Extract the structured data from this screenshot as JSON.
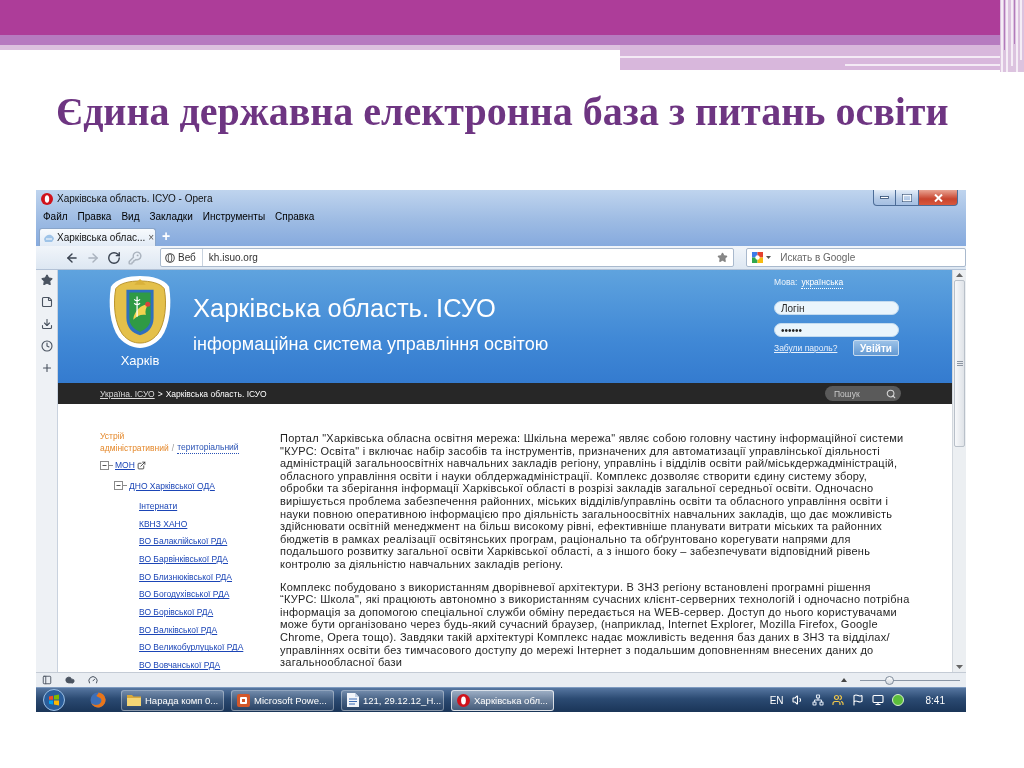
{
  "slide": {
    "title": "Єдина державна електронна база з питань освіти"
  },
  "window": {
    "title": "Харківська область. ІСУО - Opera",
    "menu": [
      "Файл",
      "Правка",
      "Вид",
      "Закладки",
      "Инструменты",
      "Справка"
    ],
    "tabs": [
      {
        "label": "Харківська облас...",
        "close": "×",
        "selected": true
      }
    ],
    "new_tab": "+",
    "nav": [
      {
        "kind": "back",
        "disabled": false
      },
      {
        "kind": "forward",
        "disabled": true
      },
      {
        "kind": "reload",
        "disabled": false
      },
      {
        "kind": "key",
        "disabled": true
      }
    ],
    "address": {
      "badge": "Веб",
      "url": "kh.isuo.org"
    },
    "search": {
      "placeholder": "Искать в Google"
    }
  },
  "page": {
    "banner": {
      "city": "Харків",
      "title": "Харківська область. ІСУО",
      "subtitle": "інформаційна система управління освітою",
      "language_label": "Мова:",
      "language": "українська",
      "login": {
        "placeholder": "Логін"
      },
      "password": {
        "value": "••••••"
      },
      "forgot_link": "Забули пароль?",
      "submit": "Увійти"
    },
    "breadcrumb": {
      "items": [
        {
          "label": "Україна. ІСУО",
          "kind": "link"
        },
        {
          "label": "Харківська область. ІСУО",
          "kind": "current"
        }
      ],
      "separator": ">"
    },
    "site_search": {
      "placeholder": "Пошук"
    },
    "structure": {
      "label": "Устрій",
      "separator": "/",
      "modes": [
        {
          "label": "адміністративний",
          "selected": true
        },
        {
          "label": "територіальний",
          "selected": false
        }
      ]
    },
    "tree": [
      {
        "label": "МОН",
        "expanded": true,
        "external": true,
        "children": [
          {
            "label": "ДНО Харківської ОДА",
            "expanded": true,
            "external": false,
            "children": [
              {
                "label": "Інтернати"
              },
              {
                "label": "КВНЗ ХАНО"
              },
              {
                "label": "ВО Балаклійської РДА"
              },
              {
                "label": "ВО Барвінківської РДА"
              },
              {
                "label": "ВО Близнюківської РДА"
              },
              {
                "label": "ВО Богодухівської РДА"
              },
              {
                "label": "ВО Борівської РДА"
              },
              {
                "label": "ВО Валківської РДА"
              },
              {
                "label": "ВО Великобурлуцької РДА"
              },
              {
                "label": "ВО Вовчанської РДА"
              }
            ]
          }
        ]
      }
    ],
    "paragraphs": [
      "Портал \"Харківська обласна освітня мережа: Шкільна мережа\" являє собою головну частину інформаційної системи \"КУРС: Освіта\" і включає набір засобів та інструментів, призначених для автоматизації управлінської діяльності адміністрацій загальноосвітніх навчальних закладів регіону, управлінь і відділів освіти рай/міськдержадміністрацій, обласного управління освіти і науки облдержадміністрації. Комплекс дозволяє створити єдину систему збору, обробки та зберігання інформації Харківської області в розрізі закладів загальної середньої освіти. Одночасно вирішується проблема забезпечення районних, міських відділів/управлінь освіти та обласного управління освіти і науки повною оперативною інформацією про діяльність загальноосвітніх навчальних закладів, що дає можливість здійснювати освітній менеджмент на більш високому рівні, ефективніше планувати витрати міських та районних бюджетів в рамках реалізації освітянських програм, раціонально та обґрунтовано корегувати напрями для подальшого розвитку загальної освіти Харківської області, а з іншого боку – забезпечувати відповідний рівень контролю за діяльністю навчальних закладів регіону.",
      "Комплекс побудовано з використанням дворівневої архітектури. В ЗНЗ регіону встановлені програмні рішення “КУРС: Школа\", які працюють автономно з використанням сучасних клієнт-серверних технологій і одночасно потрібна інформація за допомогою спеціальної служби обміну передається на WEB-сервер. Доступ до нього користувачами може бути організовано через будь-який сучасний браузер, (наприклад, Internet Explorer, Mozilla Firefox, Google Chrome, Opera тощо). Завдяки такій архітектурі Комплекс надає можливість ведення баз даних в ЗНЗ та відділах/управліннях освіти без тимчасового доступу до мережі Інтернет з подальшим доповненням внесених даних до загальнообласної бази"
    ]
  },
  "status_bar": {
    "zoom": {
      "level": 0.28
    }
  },
  "taskbar": {
    "tasks": [
      {
        "label": "Нарада комп 0...",
        "kind": "folder",
        "selected": false
      },
      {
        "label": "Microsoft Powe...",
        "kind": "presentation",
        "selected": false
      },
      {
        "label": "121, 29.12.12_H...",
        "kind": "document",
        "selected": false
      },
      {
        "label": "Харківська обл...",
        "kind": "browser",
        "selected": true
      }
    ],
    "language": "EN",
    "time": "8:41"
  }
}
